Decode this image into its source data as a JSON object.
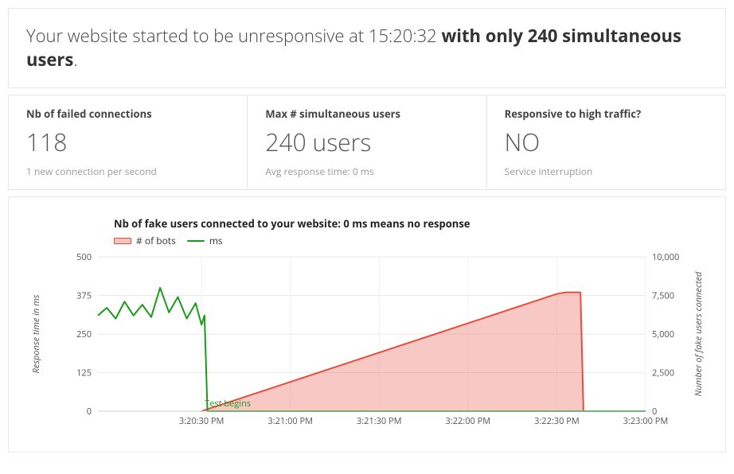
{
  "summary": {
    "prefix": "Your website started to be unresponsive at 15:20:32 ",
    "bold": "with only 240 simultaneous users",
    "suffix": "."
  },
  "stats": {
    "failed": {
      "label": "Nb of failed connections",
      "value": "118",
      "sub": "1 new connection per second"
    },
    "max": {
      "label": "Max # simultaneous users",
      "value": "240 users",
      "sub": "Avg response time: 0 ms"
    },
    "responsive": {
      "label": "Responsive to high traffic?",
      "value": "NO",
      "sub": "Service interruption"
    }
  },
  "chart_data": {
    "type": "line",
    "title": "Nb of fake users connected to your website: 0 ms means no response",
    "left_axis_label": "Response time in ms",
    "right_axis_label": "Number of fake users connected",
    "ylim_left": [
      0,
      500
    ],
    "ylim_right": [
      0,
      10000
    ],
    "y_ticks_left": [
      0,
      125,
      250,
      375,
      500
    ],
    "y_ticks_right": [
      0,
      2500,
      5000,
      7500,
      10000
    ],
    "x_ticks": [
      "3:20:30 PM",
      "3:21:00 PM",
      "3:21:30 PM",
      "3:22:00 PM",
      "3:22:30 PM",
      "3:23:00 PM"
    ],
    "annotation": {
      "text": "Test begins",
      "at_x_index": 0
    },
    "series": [
      {
        "name": "# of bots",
        "axis": "right",
        "color": "#e74c3c",
        "fill": true,
        "x": [
          "3:20:30 PM",
          "3:21:00 PM",
          "3:21:30 PM",
          "3:22:00 PM",
          "3:22:30 PM",
          "3:22:33 PM",
          "3:22:38 PM",
          "3:22:39 PM",
          "3:23:00 PM"
        ],
        "values": [
          0,
          1900,
          3800,
          5700,
          7600,
          7700,
          7700,
          0,
          0
        ]
      },
      {
        "name": "ms",
        "axis": "left",
        "color": "#1a9a1a",
        "fill": false,
        "x": [
          "3:19:55 PM",
          "3:19:58 PM",
          "3:20:01 PM",
          "3:20:04 PM",
          "3:20:07 PM",
          "3:20:10 PM",
          "3:20:13 PM",
          "3:20:16 PM",
          "3:20:19 PM",
          "3:20:22 PM",
          "3:20:25 PM",
          "3:20:28 PM",
          "3:20:30 PM",
          "3:20:31 PM",
          "3:20:32 PM",
          "3:23:00 PM"
        ],
        "values": [
          310,
          335,
          300,
          355,
          310,
          345,
          305,
          400,
          320,
          370,
          300,
          350,
          280,
          310,
          0,
          0
        ]
      }
    ],
    "legend": [
      "# of bots",
      "ms"
    ]
  }
}
